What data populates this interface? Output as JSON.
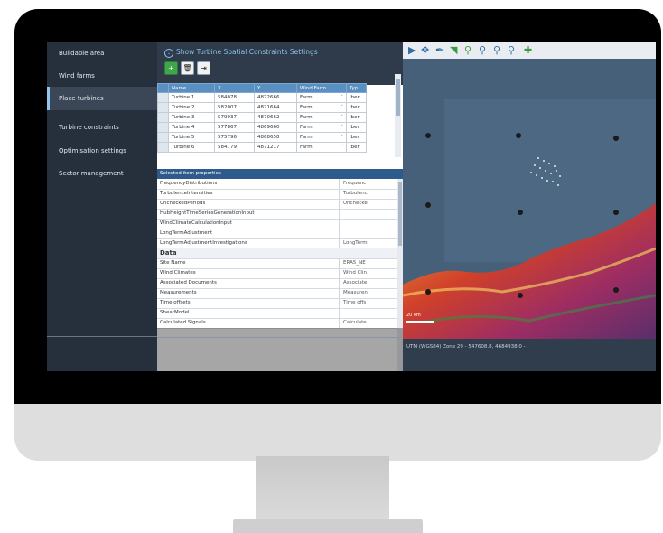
{
  "sidebar": {
    "items": [
      {
        "label": "Buildable area"
      },
      {
        "label": "Wind farms"
      },
      {
        "label": "Place turbines"
      },
      {
        "label": "Turbine constraints"
      },
      {
        "label": "Optimisation settings"
      },
      {
        "label": "Sector management"
      }
    ],
    "active_index": 2
  },
  "panel": {
    "show_link": "Show Turbine Spatial Constraints Settings",
    "toolbar": {
      "add_icon": "plus-circle-icon",
      "delete_icon": "trash-icon",
      "export_icon": "export-icon"
    }
  },
  "grid": {
    "headers": [
      "Name",
      "X",
      "Y",
      "Wind Farm",
      "Typ"
    ],
    "rows": [
      {
        "name": "Turbine 1",
        "x": "584078",
        "y": "4872666",
        "farm": "Farm",
        "type": "Iber"
      },
      {
        "name": "Turbine 2",
        "x": "582007",
        "y": "4871664",
        "farm": "Farm",
        "type": "Iber"
      },
      {
        "name": "Turbine 3",
        "x": "579937",
        "y": "4870662",
        "farm": "Farm",
        "type": "Iber"
      },
      {
        "name": "Turbine 4",
        "x": "577867",
        "y": "4869660",
        "farm": "Farm",
        "type": "Iber"
      },
      {
        "name": "Turbine 5",
        "x": "575796",
        "y": "4868658",
        "farm": "Farm",
        "type": "Iber"
      },
      {
        "name": "Turbine 6",
        "x": "584779",
        "y": "4871217",
        "farm": "Farm",
        "type": "Iber"
      }
    ]
  },
  "properties": {
    "header": "Selected item properties",
    "rows": [
      {
        "key": "FrequencyDistributions",
        "value": "Frequenc"
      },
      {
        "key": "TurbulenceIntensities",
        "value": "Turbulenc"
      },
      {
        "key": "UncheckedPeriods",
        "value": "Unchecke"
      },
      {
        "key": "HubHeightTimeSeriesGenerationInput",
        "value": ""
      },
      {
        "key": "WindClimateCalculationInput",
        "value": ""
      },
      {
        "key": "LongTermAdjustment",
        "value": ""
      },
      {
        "key": "LongTermAdjustmentInvestigations",
        "value": "LongTerm"
      },
      {
        "key": "Data",
        "value": "",
        "section": true
      },
      {
        "key": "Site Name",
        "value": "ERA5_NE"
      },
      {
        "key": "Wind Climates",
        "value": "Wind Clin"
      },
      {
        "key": "Associated Documents",
        "value": "Associate"
      },
      {
        "key": "Measurements",
        "value": "Measuren"
      },
      {
        "key": "Time offsets",
        "value": "Time offs"
      },
      {
        "key": "ShearModel",
        "value": ""
      },
      {
        "key": "Calculated Signals",
        "value": "Calculate"
      }
    ]
  },
  "map": {
    "status": "UTM (WGS84) Zone 29 - 547608.8, 4684938.0 -",
    "scale_label": "20 km",
    "tools": [
      "pointer-icon",
      "pan-icon",
      "measure-icon",
      "ruler-icon",
      "zoom-in-icon",
      "zoom-out-icon",
      "zoom-box-icon",
      "zoom-extent-icon",
      "add-turbine-icon"
    ]
  }
}
